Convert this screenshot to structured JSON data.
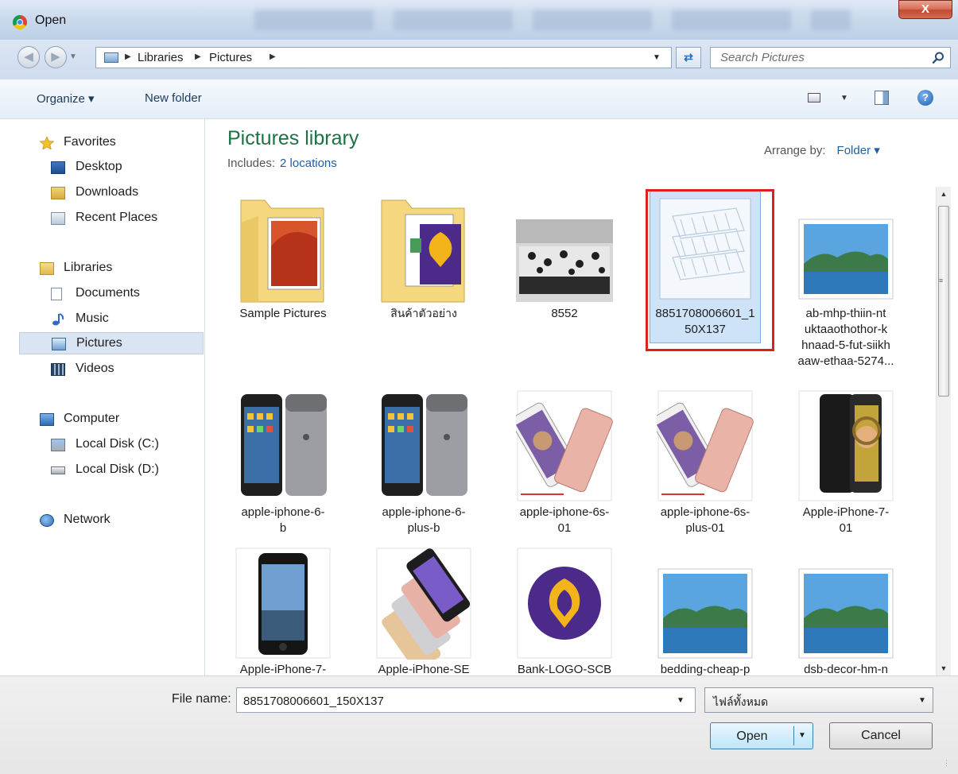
{
  "window": {
    "title": "Open",
    "close_label": "X"
  },
  "address_bar": {
    "breadcrumbs": [
      "Libraries",
      "Pictures"
    ],
    "search_placeholder": "Search Pictures"
  },
  "toolbar": {
    "organize_label": "Organize ▾",
    "new_folder_label": "New folder"
  },
  "nav": {
    "favorites": {
      "label": "Favorites",
      "items": [
        "Desktop",
        "Downloads",
        "Recent Places"
      ]
    },
    "libraries": {
      "label": "Libraries",
      "items": [
        "Documents",
        "Music",
        "Pictures",
        "Videos"
      ],
      "selected": "Pictures"
    },
    "computer": {
      "label": "Computer",
      "items": [
        "Local Disk (C:)",
        "Local Disk (D:)"
      ]
    },
    "network": {
      "label": "Network"
    }
  },
  "content": {
    "title": "Pictures library",
    "includes_label": "Includes:",
    "includes_link": "2 locations",
    "arrange_label": "Arrange by:",
    "arrange_value": "Folder ▾",
    "items": [
      {
        "label": "Sample Pictures",
        "type": "folder"
      },
      {
        "label": "สินค้าตัวอย่าง",
        "type": "folder"
      },
      {
        "label": "8552",
        "type": "image"
      },
      {
        "label": "8851708006601_1\n50X137",
        "type": "image",
        "selected": true
      },
      {
        "label": "ab-mhp-thiin-nt\nuktaaothothor-k\nhnaad-5-fut-siikh\naaw-ethaa-5274...",
        "type": "image"
      },
      {
        "label": "apple-iphone-6-\nb",
        "type": "image"
      },
      {
        "label": "apple-iphone-6-\nplus-b",
        "type": "image"
      },
      {
        "label": "apple-iphone-6s-\n01",
        "type": "image"
      },
      {
        "label": "apple-iphone-6s-\nplus-01",
        "type": "image"
      },
      {
        "label": "Apple-iPhone-7-\n01",
        "type": "image"
      },
      {
        "label": "Apple-iPhone-7-",
        "type": "image"
      },
      {
        "label": "Apple-iPhone-SE",
        "type": "image"
      },
      {
        "label": "Bank-LOGO-SCB",
        "type": "image"
      },
      {
        "label": "bedding-cheap-p",
        "type": "image"
      },
      {
        "label": "dsb-decor-hm-n",
        "type": "image"
      }
    ]
  },
  "footer": {
    "file_name_label": "File name:",
    "file_name_value": "8851708006601_150X137",
    "file_type_value": "ไฟล์ทั้งหมด",
    "open_label": "Open",
    "cancel_label": "Cancel"
  },
  "colors": {
    "title_green": "#1e7145",
    "link_blue": "#1f5fa8",
    "highlight": "#e0201d",
    "selection": "#cfe3f8"
  }
}
